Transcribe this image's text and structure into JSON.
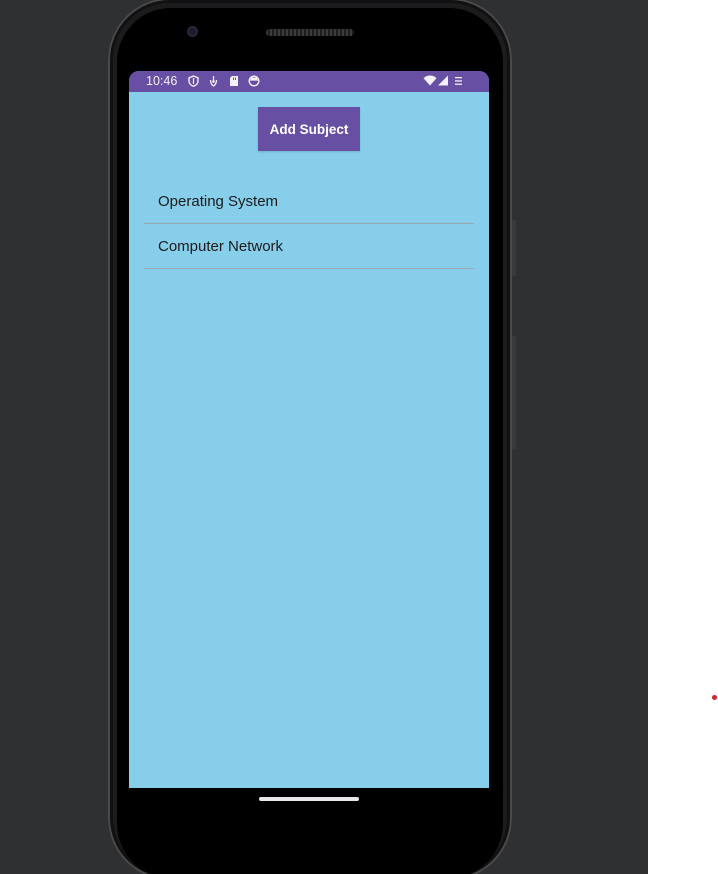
{
  "status_bar": {
    "time": "10:46",
    "icons": [
      "shield-icon",
      "location-icon",
      "sd-card-icon",
      "sync-icon"
    ],
    "right_icons": [
      "wifi-icon",
      "signal-icon",
      "battery-icon"
    ],
    "color": "#6750a4"
  },
  "toolbar": {
    "add_label": "Add Subject"
  },
  "subjects": {
    "items": [
      {
        "label": "Operating System"
      },
      {
        "label": "Computer Network"
      }
    ]
  },
  "colors": {
    "screen_background": "#87ceeb",
    "accent": "#6750a4",
    "emulator_background": "#2f3032"
  }
}
